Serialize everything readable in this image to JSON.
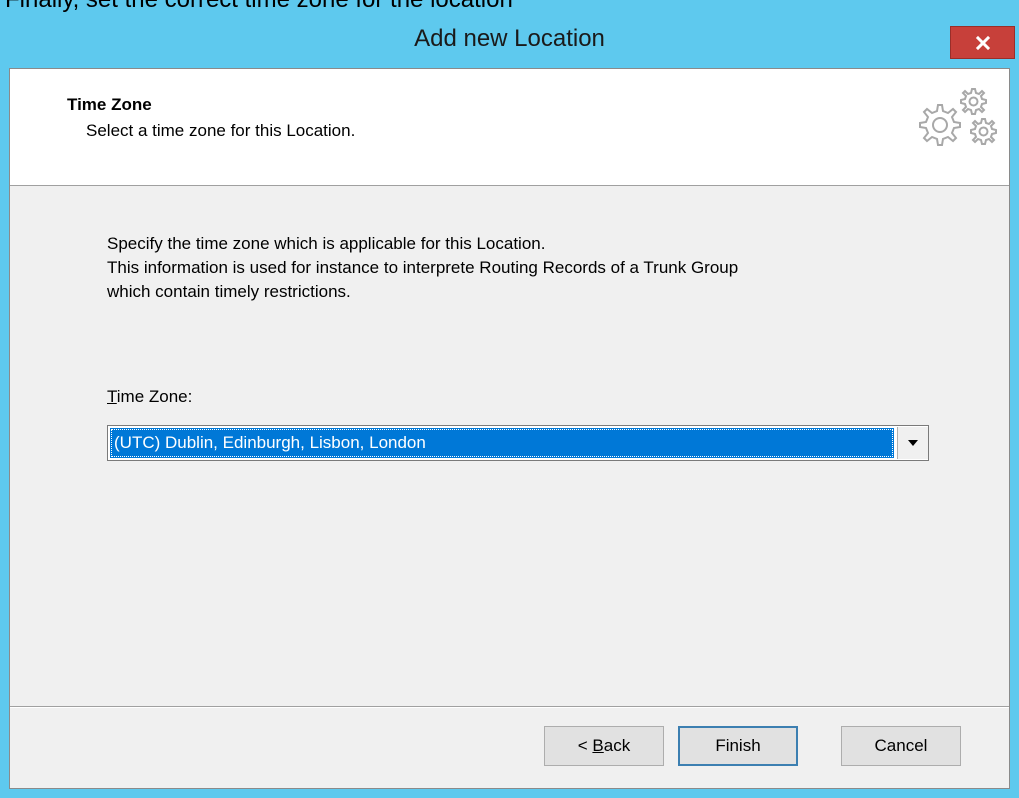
{
  "caption": "Finally, set the correct time zone for the location",
  "window": {
    "title": "Add new Location",
    "close_label": "x"
  },
  "header": {
    "title": "Time Zone",
    "subtitle": "Select a time zone for this Location.",
    "icon": "gears-icon"
  },
  "body": {
    "description_lines": [
      "Specify the time zone which is applicable for this Location.",
      "This information is used for instance to interprete Routing Records of a Trunk Group",
      "which contain timely restrictions."
    ],
    "time_zone_label_accel": "T",
    "time_zone_label_rest": "ime Zone:",
    "time_zone_value": "(UTC) Dublin, Edinburgh, Lisbon, London"
  },
  "buttons": {
    "back_prefix": "< ",
    "back_accel": "B",
    "back_rest": "ack",
    "finish": "Finish",
    "cancel": "Cancel"
  },
  "colors": {
    "titlebar": "#5ec9ee",
    "close": "#c7403a",
    "selection": "#0078d7"
  }
}
